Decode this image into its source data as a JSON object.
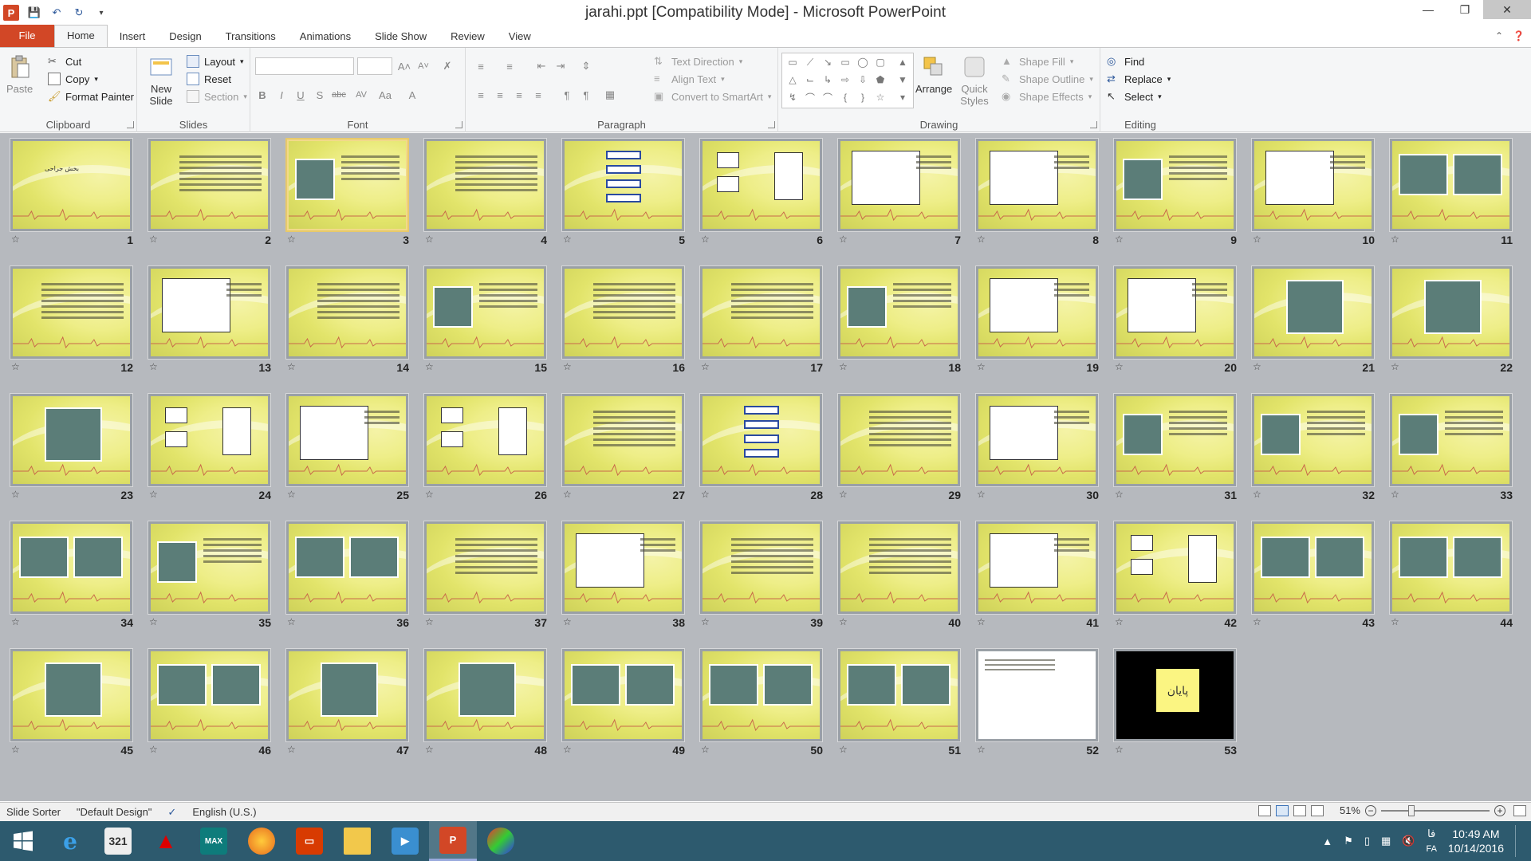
{
  "titlebar": {
    "title": "jarahi.ppt [Compatibility Mode] - Microsoft PowerPoint",
    "app_icon_letter": "P"
  },
  "tabs": [
    {
      "label": "File"
    },
    {
      "label": "Home"
    },
    {
      "label": "Insert"
    },
    {
      "label": "Design"
    },
    {
      "label": "Transitions"
    },
    {
      "label": "Animations"
    },
    {
      "label": "Slide Show"
    },
    {
      "label": "Review"
    },
    {
      "label": "View"
    }
  ],
  "ribbon": {
    "clipboard": {
      "label": "Clipboard",
      "paste": "Paste",
      "cut": "Cut",
      "copy": "Copy",
      "format_painter": "Format Painter"
    },
    "slides": {
      "label": "Slides",
      "new_slide": "New Slide",
      "layout": "Layout",
      "reset": "Reset",
      "section": "Section"
    },
    "font": {
      "label": "Font"
    },
    "paragraph": {
      "label": "Paragraph",
      "text_direction": "Text Direction",
      "align_text": "Align Text",
      "convert_smartart": "Convert to SmartArt"
    },
    "drawing": {
      "label": "Drawing",
      "arrange": "Arrange",
      "quick_styles": "Quick Styles",
      "shape_fill": "Shape Fill",
      "shape_outline": "Shape Outline",
      "shape_effects": "Shape Effects"
    },
    "editing": {
      "label": "Editing",
      "find": "Find",
      "replace": "Replace",
      "select": "Select"
    }
  },
  "slides": [
    {
      "n": "1",
      "kind": "title",
      "caption": "بخش جراحی"
    },
    {
      "n": "2",
      "kind": "text"
    },
    {
      "n": "3",
      "kind": "picture-text",
      "selected": true
    },
    {
      "n": "4",
      "kind": "text"
    },
    {
      "n": "5",
      "kind": "boxes"
    },
    {
      "n": "6",
      "kind": "diagram"
    },
    {
      "n": "7",
      "kind": "figure"
    },
    {
      "n": "8",
      "kind": "figure"
    },
    {
      "n": "9",
      "kind": "picture-text"
    },
    {
      "n": "10",
      "kind": "figure"
    },
    {
      "n": "11",
      "kind": "pictures"
    },
    {
      "n": "12",
      "kind": "text"
    },
    {
      "n": "13",
      "kind": "figure"
    },
    {
      "n": "14",
      "kind": "text"
    },
    {
      "n": "15",
      "kind": "picture-text"
    },
    {
      "n": "16",
      "kind": "text"
    },
    {
      "n": "17",
      "kind": "text"
    },
    {
      "n": "18",
      "kind": "picture-text"
    },
    {
      "n": "19",
      "kind": "figure"
    },
    {
      "n": "20",
      "kind": "figure"
    },
    {
      "n": "21",
      "kind": "picture"
    },
    {
      "n": "22",
      "kind": "picture"
    },
    {
      "n": "23",
      "kind": "picture"
    },
    {
      "n": "24",
      "kind": "diagram"
    },
    {
      "n": "25",
      "kind": "figure"
    },
    {
      "n": "26",
      "kind": "diagram"
    },
    {
      "n": "27",
      "kind": "text"
    },
    {
      "n": "28",
      "kind": "boxes"
    },
    {
      "n": "29",
      "kind": "text"
    },
    {
      "n": "30",
      "kind": "figure"
    },
    {
      "n": "31",
      "kind": "picture-text"
    },
    {
      "n": "32",
      "kind": "picture-text"
    },
    {
      "n": "33",
      "kind": "picture-text"
    },
    {
      "n": "34",
      "kind": "pictures"
    },
    {
      "n": "35",
      "kind": "picture-text"
    },
    {
      "n": "36",
      "kind": "pictures"
    },
    {
      "n": "37",
      "kind": "text"
    },
    {
      "n": "38",
      "kind": "figure"
    },
    {
      "n": "39",
      "kind": "text"
    },
    {
      "n": "40",
      "kind": "text"
    },
    {
      "n": "41",
      "kind": "figure"
    },
    {
      "n": "42",
      "kind": "diagram"
    },
    {
      "n": "43",
      "kind": "pictures"
    },
    {
      "n": "44",
      "kind": "pictures"
    },
    {
      "n": "45",
      "kind": "picture"
    },
    {
      "n": "46",
      "kind": "pictures"
    },
    {
      "n": "47",
      "kind": "picture"
    },
    {
      "n": "48",
      "kind": "picture"
    },
    {
      "n": "49",
      "kind": "pictures"
    },
    {
      "n": "50",
      "kind": "pictures"
    },
    {
      "n": "51",
      "kind": "pictures"
    },
    {
      "n": "52",
      "kind": "white"
    },
    {
      "n": "53",
      "kind": "end",
      "caption": "پایان"
    }
  ],
  "statusbar": {
    "view": "Slide Sorter",
    "theme": "\"Default Design\"",
    "language": "English (U.S.)",
    "zoom": "51%"
  },
  "taskbar": {
    "apps": [
      "Internet Explorer",
      "Calendar",
      "Adobe Acrobat",
      "3ds Max",
      "Firefox",
      "Office",
      "File Explorer",
      "Media Player",
      "PowerPoint",
      "Paint"
    ],
    "lang": "FA",
    "lang_fa": "فا",
    "time": "10:49 AM",
    "date": "10/14/2016"
  }
}
